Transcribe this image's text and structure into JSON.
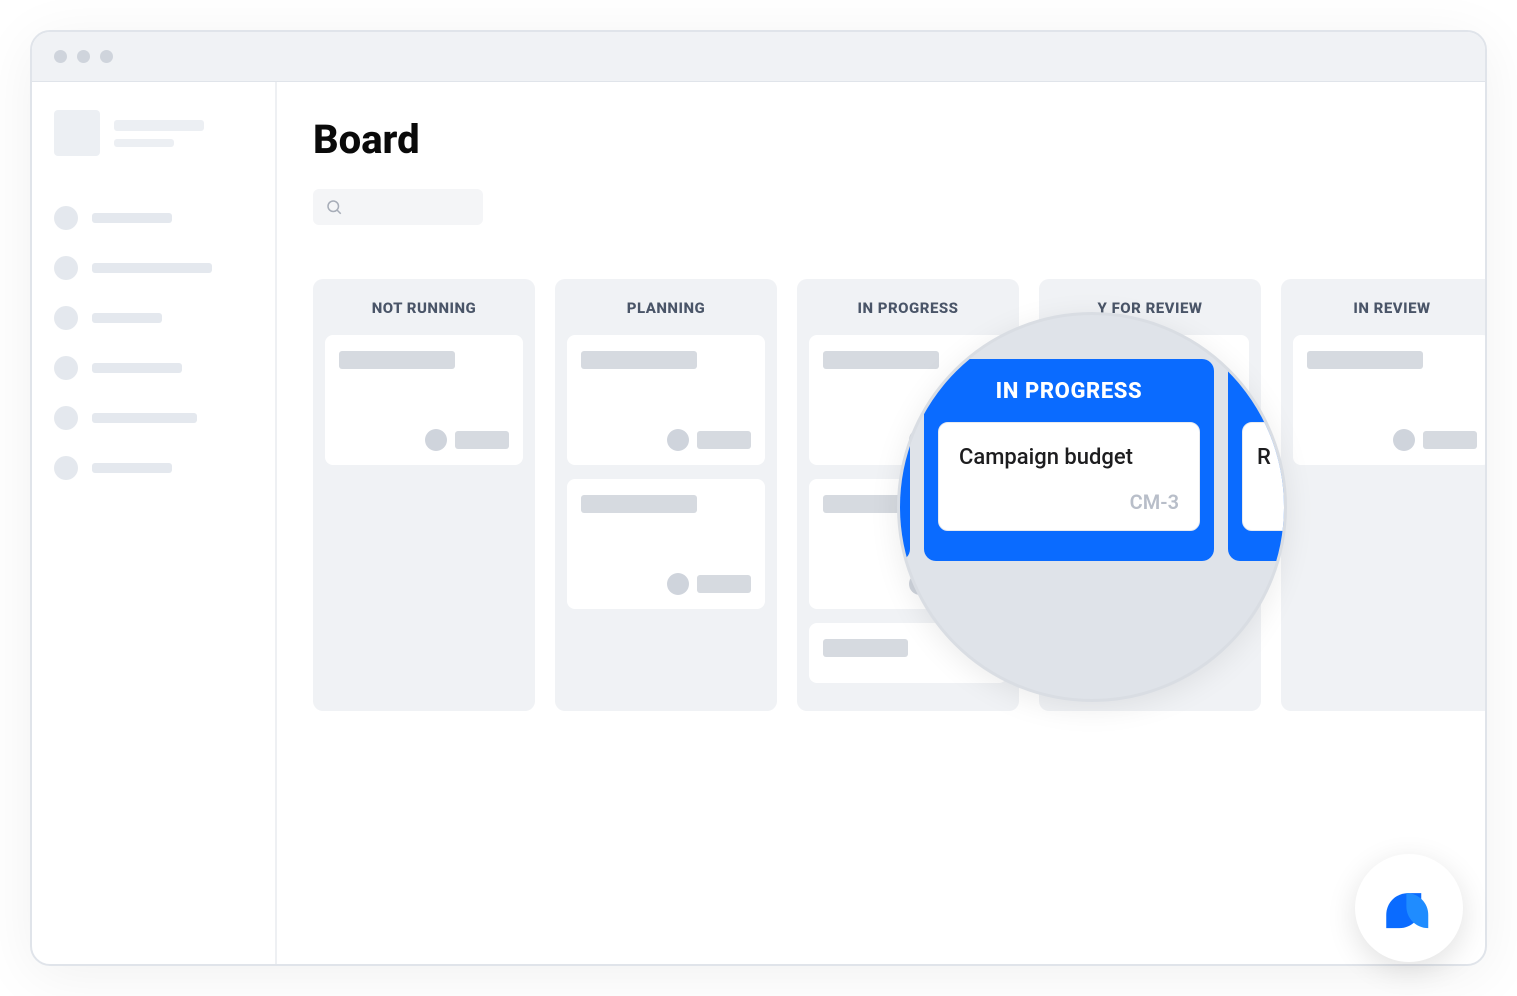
{
  "page": {
    "title": "Board"
  },
  "search": {
    "placeholder": ""
  },
  "columns": [
    {
      "header": "NOT RUNNING"
    },
    {
      "header": "PLANNING"
    },
    {
      "header": "IN PROGRESS"
    },
    {
      "header": "READY FOR REVIEW",
      "display_fragment": "Y FOR REVIEW"
    },
    {
      "header": "IN REVIEW"
    }
  ],
  "magnifier": {
    "column_header": "IN PROGRESS",
    "card": {
      "title": "Campaign budget",
      "id": "CM-3"
    },
    "partial_card_text": "R"
  }
}
